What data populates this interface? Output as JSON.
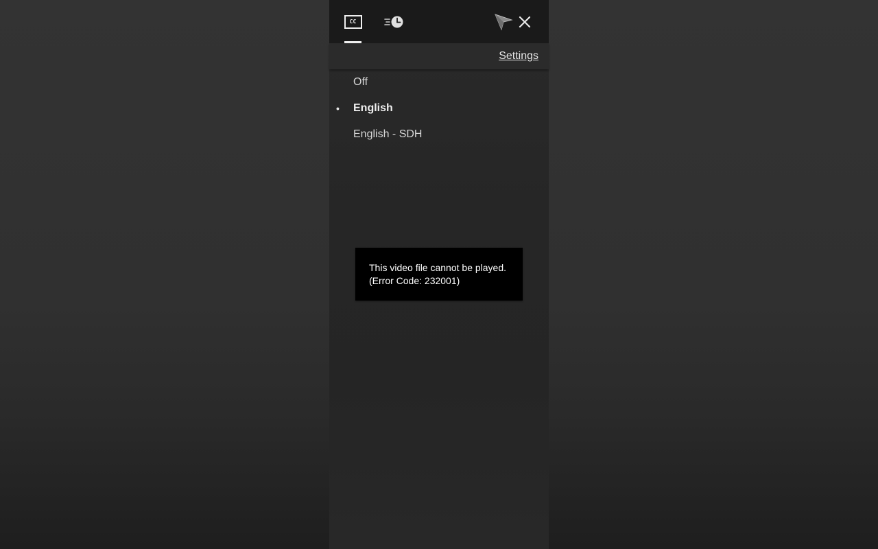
{
  "toolbar": {
    "tabs": [
      {
        "icon": "closed-captions-icon",
        "label": "CC",
        "active": true
      },
      {
        "icon": "playback-speed-icon",
        "active": false
      }
    ],
    "pointer_icon": "cursor-pointer-icon",
    "close_icon": "close-icon"
  },
  "subtitles": {
    "settings_label": "Settings",
    "languages": [
      {
        "label": "Off",
        "selected": false
      },
      {
        "label": "English",
        "selected": true
      },
      {
        "label": "English - SDH",
        "selected": false
      }
    ],
    "selected_marker": "•"
  },
  "error": {
    "line1": "This video file cannot be played.",
    "line2": "(Error Code: 232001)"
  },
  "colors": {
    "panel_background": "#262626",
    "toolbar_background": "#1a1a1a",
    "text": "#d9d9d9",
    "error_background": "#000000"
  }
}
